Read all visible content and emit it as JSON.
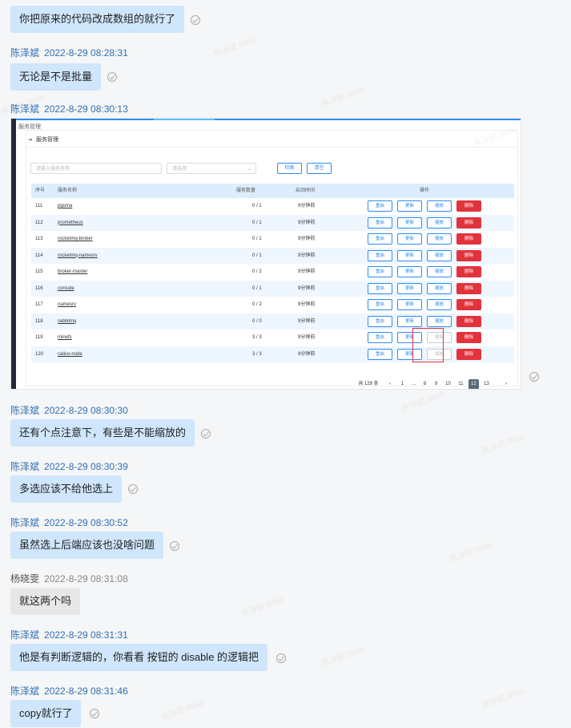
{
  "messages": [
    {
      "sender": "",
      "time": "",
      "text": "你把原来的代码改成数组的就行了"
    },
    {
      "sender": "陈泽斌",
      "time": "2022-8-29 08:28:31",
      "text": "无论是不是批量"
    },
    {
      "sender": "陈泽斌",
      "time": "2022-8-29 08:30:13",
      "text": ""
    },
    {
      "sender": "陈泽斌",
      "time": "2022-8-29 08:30:30",
      "text": "还有个点注意下，有些是不能缩放的"
    },
    {
      "sender": "陈泽斌",
      "time": "2022-8-29 08:30:39",
      "text": "多选应该不给他选上"
    },
    {
      "sender": "陈泽斌",
      "time": "2022-8-29 08:30:52",
      "text": "虽然选上后端应该也没啥问题"
    },
    {
      "sender": "杨晓雯",
      "time": "2022-8-29 08:31:08",
      "text": "就这两个吗"
    },
    {
      "sender": "陈泽斌",
      "time": "2022-8-29 08:31:31",
      "text": "他是有判断逻辑的，你看看 按钮的 disable 的逻辑把"
    },
    {
      "sender": "陈泽斌",
      "time": "2022-8-29 08:31:46",
      "text": "copy就行了"
    }
  ],
  "watermark": "陈泽斌 9856",
  "screenshot": {
    "crumb": "服务管理",
    "panel_title": "服务管理",
    "search_placeholder": "请输入服务名称",
    "select_placeholder": "请选择",
    "search_button": "检索",
    "clear_button": "清空",
    "columns": [
      "序号",
      "服务名称",
      "服务数量",
      "启动时间",
      "操作"
    ],
    "rows": [
      {
        "id": "111",
        "name": "pgoma",
        "count": "0 / 1",
        "time": "9分钟前",
        "scale_disabled": false
      },
      {
        "id": "112",
        "name": "prometheus",
        "count": "0 / 1",
        "time": "9分钟前",
        "scale_disabled": false
      },
      {
        "id": "113",
        "name": "rocketmq-broker",
        "count": "0 / 1",
        "time": "9分钟前",
        "scale_disabled": false
      },
      {
        "id": "114",
        "name": "rocketmq-namesrv",
        "count": "0 / 1",
        "time": "9分钟前",
        "scale_disabled": false
      },
      {
        "id": "115",
        "name": "broker-master",
        "count": "0 / 2",
        "time": "9分钟前",
        "scale_disabled": false
      },
      {
        "id": "116",
        "name": "console",
        "count": "0 / 1",
        "time": "9分钟前",
        "scale_disabled": false
      },
      {
        "id": "117",
        "name": "namesrv",
        "count": "0 / 2",
        "time": "9分钟前",
        "scale_disabled": false
      },
      {
        "id": "118",
        "name": "rabbitmq",
        "count": "0 / 0",
        "time": "9分钟前",
        "scale_disabled": false
      },
      {
        "id": "119",
        "name": "minefs",
        "count": "3 / 3",
        "time": "9分钟前",
        "scale_disabled": true
      },
      {
        "id": "120",
        "name": "calico-node",
        "count": "3 / 3",
        "time": "9分钟前",
        "scale_disabled": true
      }
    ],
    "actions": {
      "restart": "重启",
      "update": "更新",
      "scale": "缩放",
      "delete": "删除"
    },
    "pager": {
      "total": "共 129 条",
      "prev": "‹",
      "next": "›",
      "pages": [
        "1",
        "…",
        "8",
        "9",
        "10",
        "11",
        "12",
        "13"
      ],
      "current": "12"
    }
  }
}
